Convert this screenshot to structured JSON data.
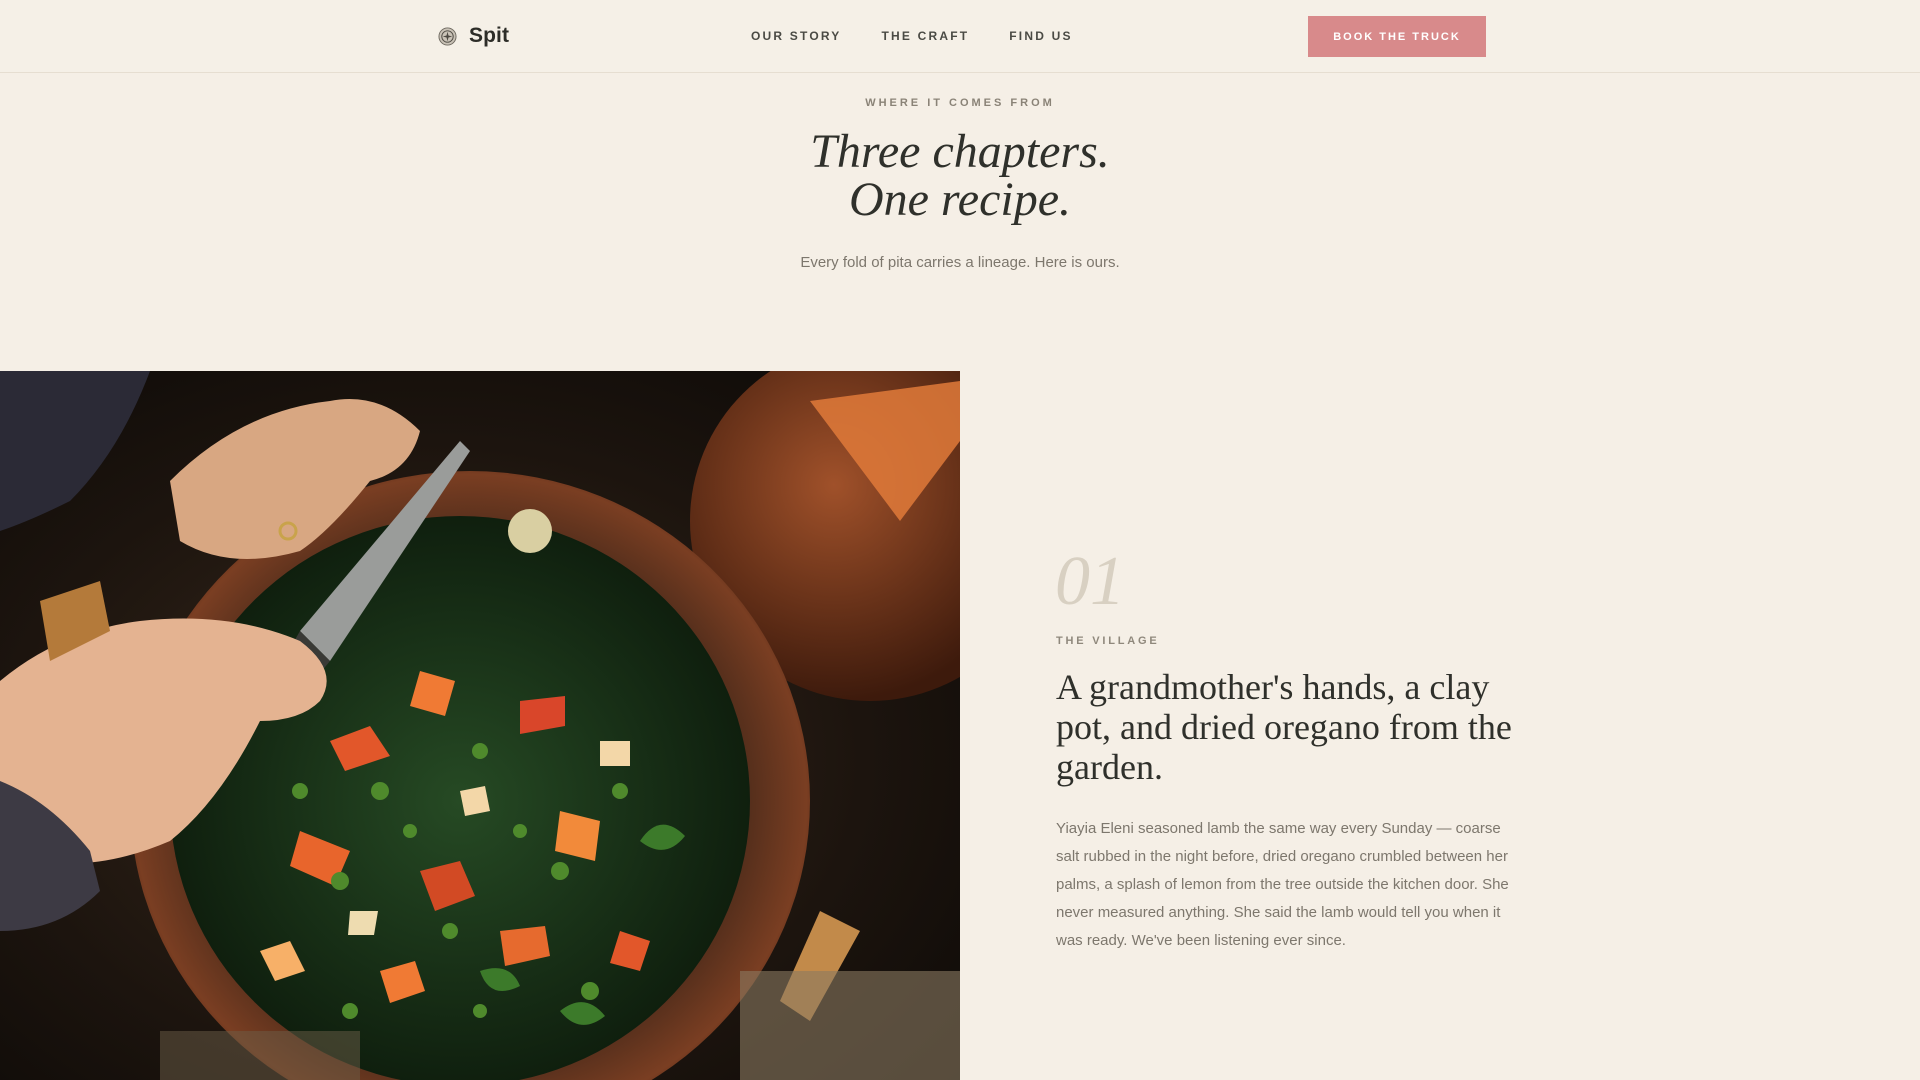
{
  "header": {
    "brand": "Spit",
    "nav": [
      "OUR STORY",
      "THE CRAFT",
      "FIND US"
    ],
    "cta": "BOOK THE TRUCK",
    "brand_icon": "seal-icon"
  },
  "intro": {
    "eyebrow": "WHERE IT COMES FROM",
    "title_line1": "Three chapters.",
    "title_line2": "One recipe.",
    "subtitle": "Every fold of pita carries a lineage. Here is ours."
  },
  "chapter": {
    "number": "01",
    "label": "THE VILLAGE",
    "title": "A grandmother's hands, a clay pot, and dried oregano from the garden.",
    "body": "Yiayia Eleni seasoned lamb the same way every Sunday — coarse salt rubbed in the night before, dried oregano crumbled between her palms, a splash of lemon from the tree outside the kitchen door. She never measured anything. She said the lamb would tell you when it was ready. We've been listening ever since."
  },
  "colors": {
    "background": "#f5efe6",
    "accent": "#d88a8b",
    "text": "#2f302b",
    "muted": "#7d776d"
  }
}
